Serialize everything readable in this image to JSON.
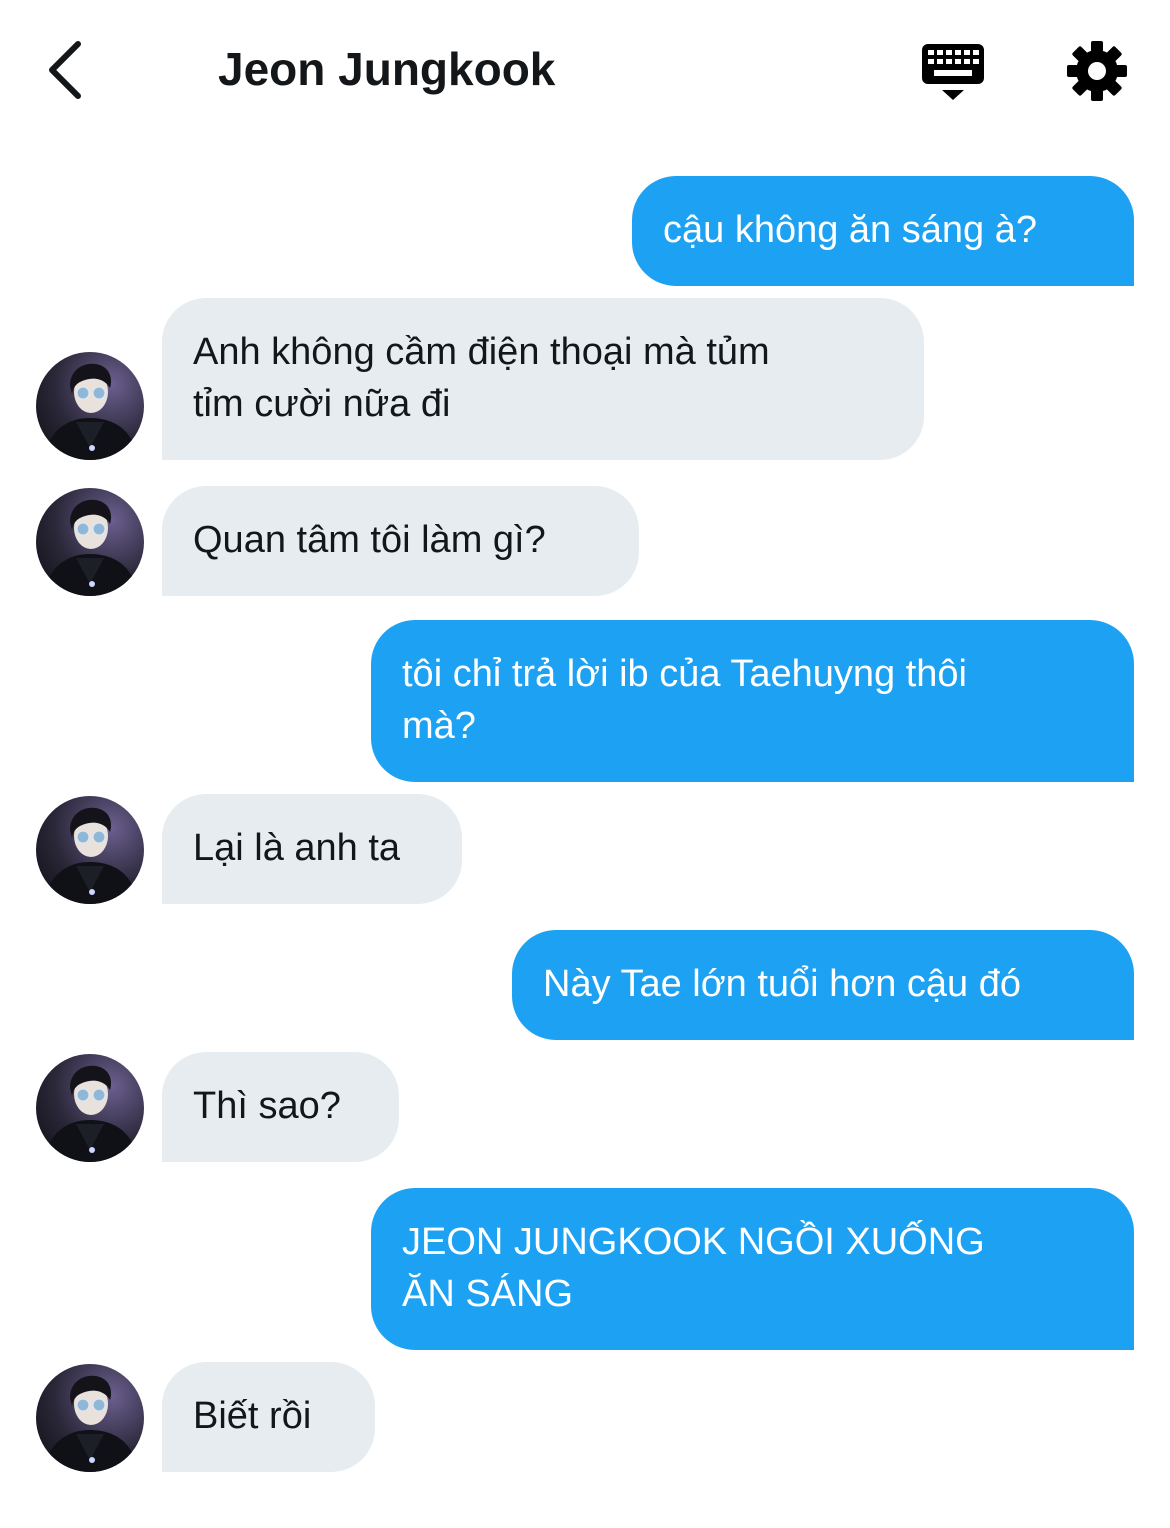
{
  "header": {
    "title": "Jeon Jungkook",
    "icons": {
      "back": "chevron-left-icon",
      "keyboard": "keyboard-icon",
      "settings": "gear-icon"
    }
  },
  "contact": {
    "avatar": "avatar-photo"
  },
  "colors": {
    "outgoing": "#1da1f2",
    "incoming": "#e6ecf0",
    "text": "#14171a"
  },
  "messages": [
    {
      "from": "me",
      "text": "cậu không ăn sáng à?"
    },
    {
      "from": "them",
      "text": "Anh không cầm điện thoại mà tủm\ntỉm cười nữa đi"
    },
    {
      "from": "them",
      "text": "Quan tâm tôi làm gì?"
    },
    {
      "from": "me",
      "text": "tôi chỉ trả lời ib của Taehuyng thôi\nmà?"
    },
    {
      "from": "them",
      "text": "Lại là anh ta"
    },
    {
      "from": "me",
      "text": "Này Tae lớn tuổi hơn cậu đó"
    },
    {
      "from": "them",
      "text": "Thì sao?"
    },
    {
      "from": "me",
      "text": "JEON JUNGKOOK NGỒI XUỐNG\nĂN SÁNG"
    },
    {
      "from": "them",
      "text": "Biết rồi"
    }
  ]
}
